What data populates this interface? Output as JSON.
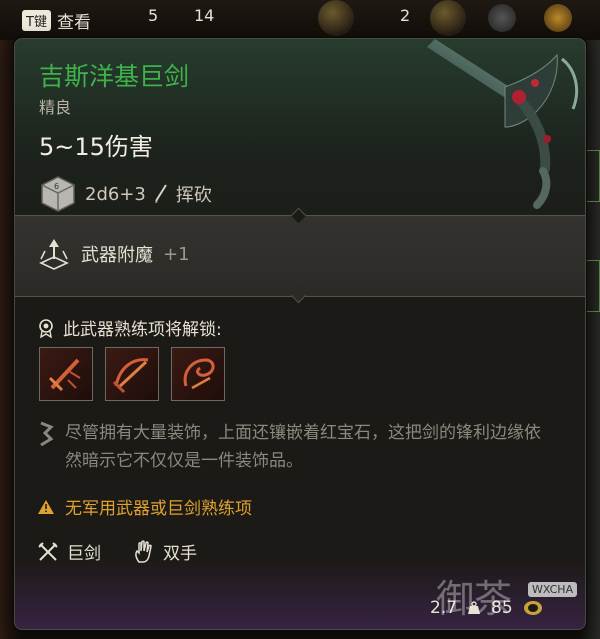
{
  "background": {
    "key_hint": {
      "key": "T键",
      "label": "查看"
    },
    "slot_counts": [
      "5",
      "14",
      "2"
    ],
    "stats": {
      "weight": "2.7",
      "value": "85"
    }
  },
  "tooltip": {
    "item_name": "吉斯洋基巨剑",
    "rarity": "精良",
    "damage": "5~15伤害",
    "dice": {
      "formula": "2d6+3",
      "damage_type": "挥砍"
    },
    "enchant": {
      "label": "武器附魔",
      "value": "+1"
    },
    "unlock": {
      "title": "此武器熟练项将解锁:",
      "skills": [
        "skill-icon-1",
        "skill-icon-2",
        "skill-icon-3"
      ]
    },
    "description": "尽管拥有大量装饰，上面还镶嵌着红宝石，这把剑的锋利边缘依然暗示它不仅仅是一件装饰品。",
    "warning": "无军用武器或巨剑熟练项",
    "properties": [
      {
        "icon": "crossed-swords-icon",
        "label": "巨剑"
      },
      {
        "icon": "hand-icon",
        "label": "双手"
      }
    ]
  },
  "watermark": {
    "text": "御茶",
    "badge": "WXCHA"
  },
  "colors": {
    "item_name": "#3fb24a",
    "warning": "#e0a22e",
    "muted": "#8d877d"
  }
}
